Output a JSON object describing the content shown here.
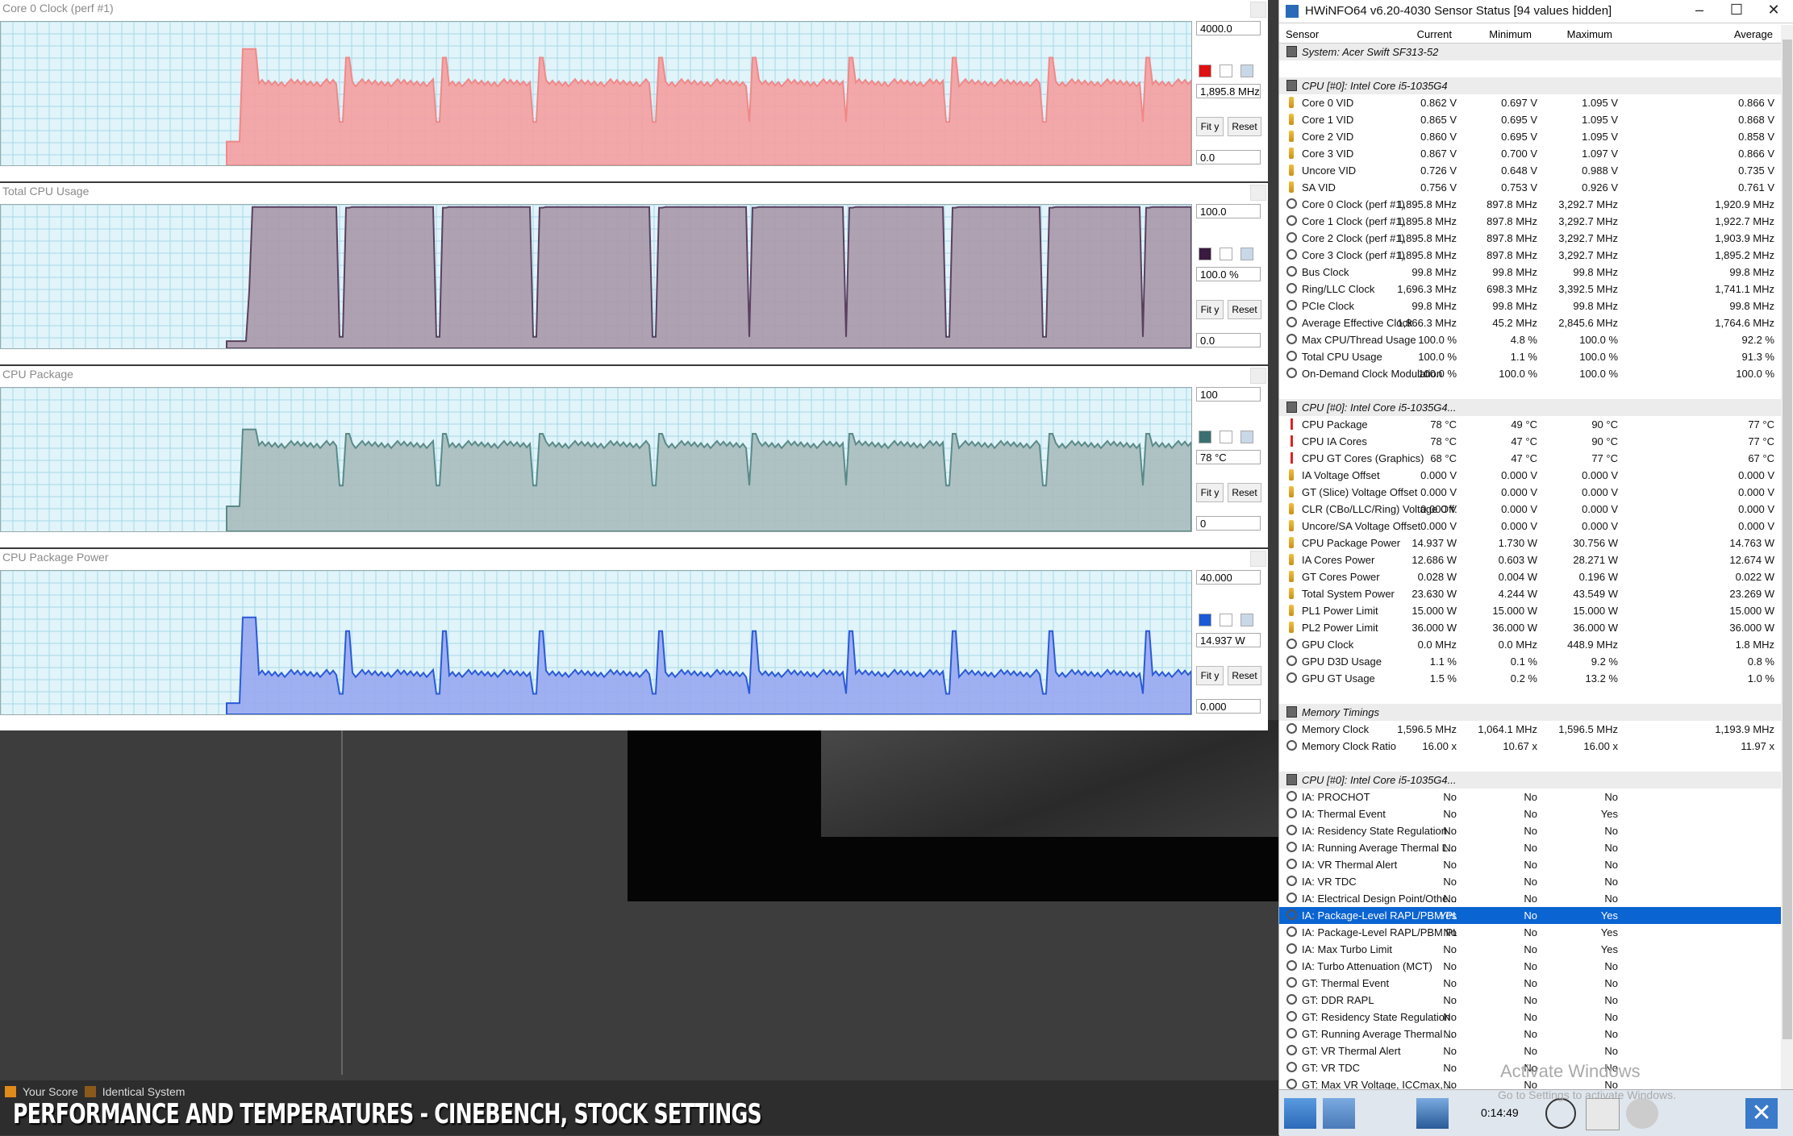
{
  "graphs": [
    {
      "title": "Core 0 Clock (perf #1)",
      "max": "4000.0",
      "current": "1,895.8 MHz",
      "min": "0.0",
      "fit": "Fit y",
      "reset": "Reset",
      "color": "#f08888",
      "fill": "#f4a0a0",
      "swatch": "#e01010"
    },
    {
      "title": "Total CPU Usage",
      "max": "100.0",
      "current": "100.0 %",
      "min": "0.0",
      "fit": "Fit y",
      "reset": "Reset",
      "color": "#5a4060",
      "fill": "#a898a8",
      "swatch": "#3a1a40"
    },
    {
      "title": "CPU Package",
      "max": "100",
      "current": "78 °C",
      "min": "0",
      "fit": "Fit y",
      "reset": "Reset",
      "color": "#5a8a88",
      "fill": "#a8bcbc",
      "swatch": "#3a7070"
    },
    {
      "title": "CPU Package Power",
      "max": "40.000",
      "current": "14.937 W",
      "min": "0.000",
      "fit": "Fit y",
      "reset": "Reset",
      "color": "#2a5ad8",
      "fill": "#98a8f0",
      "swatch": "#1a5ad8"
    }
  ],
  "hwinfo": {
    "title": "HWiNFO64 v6.20-4030 Sensor Status [94 values hidden]",
    "headers": [
      "Sensor",
      "Current",
      "Minimum",
      "Maximum",
      "Average"
    ],
    "rows": [
      {
        "name": "System: Acer Swift SF313-52",
        "group": true,
        "icon": "chip"
      },
      {
        "spacer": true
      },
      {
        "name": "CPU [#0]: Intel Core i5-1035G4",
        "group": true,
        "icon": "chip"
      },
      {
        "name": "Core 0 VID",
        "icon": "volt",
        "v": [
          "0.862 V",
          "0.697 V",
          "1.095 V",
          "0.866 V"
        ]
      },
      {
        "name": "Core 1 VID",
        "icon": "volt",
        "v": [
          "0.865 V",
          "0.695 V",
          "1.095 V",
          "0.868 V"
        ]
      },
      {
        "name": "Core 2 VID",
        "icon": "volt",
        "v": [
          "0.860 V",
          "0.695 V",
          "1.095 V",
          "0.858 V"
        ]
      },
      {
        "name": "Core 3 VID",
        "icon": "volt",
        "v": [
          "0.867 V",
          "0.700 V",
          "1.097 V",
          "0.866 V"
        ]
      },
      {
        "name": "Uncore VID",
        "icon": "volt",
        "v": [
          "0.726 V",
          "0.648 V",
          "0.988 V",
          "0.735 V"
        ]
      },
      {
        "name": "SA VID",
        "icon": "volt",
        "v": [
          "0.756 V",
          "0.753 V",
          "0.926 V",
          "0.761 V"
        ]
      },
      {
        "name": "Core 0 Clock (perf #1)",
        "icon": "clock",
        "v": [
          "1,895.8 MHz",
          "897.8 MHz",
          "3,292.7 MHz",
          "1,920.9 MHz"
        ]
      },
      {
        "name": "Core 1 Clock (perf #1)",
        "icon": "clock",
        "v": [
          "1,895.8 MHz",
          "897.8 MHz",
          "3,292.7 MHz",
          "1,922.7 MHz"
        ]
      },
      {
        "name": "Core 2 Clock (perf #1)",
        "icon": "clock",
        "v": [
          "1,895.8 MHz",
          "897.8 MHz",
          "3,292.7 MHz",
          "1,903.9 MHz"
        ]
      },
      {
        "name": "Core 3 Clock (perf #1)",
        "icon": "clock",
        "v": [
          "1,895.8 MHz",
          "897.8 MHz",
          "3,292.7 MHz",
          "1,895.2 MHz"
        ]
      },
      {
        "name": "Bus Clock",
        "icon": "clock",
        "v": [
          "99.8 MHz",
          "99.8 MHz",
          "99.8 MHz",
          "99.8 MHz"
        ]
      },
      {
        "name": "Ring/LLC Clock",
        "icon": "clock",
        "v": [
          "1,696.3 MHz",
          "698.3 MHz",
          "3,392.5 MHz",
          "1,741.1 MHz"
        ]
      },
      {
        "name": "PCIe Clock",
        "icon": "clock",
        "v": [
          "99.8 MHz",
          "99.8 MHz",
          "99.8 MHz",
          "99.8 MHz"
        ]
      },
      {
        "name": "Average Effective Clock",
        "icon": "clock",
        "v": [
          "1,866.3 MHz",
          "45.2 MHz",
          "2,845.6 MHz",
          "1,764.6 MHz"
        ]
      },
      {
        "name": "Max CPU/Thread Usage",
        "icon": "clock",
        "v": [
          "100.0 %",
          "4.8 %",
          "100.0 %",
          "92.2 %"
        ]
      },
      {
        "name": "Total CPU Usage",
        "icon": "clock",
        "v": [
          "100.0 %",
          "1.1 %",
          "100.0 %",
          "91.3 %"
        ]
      },
      {
        "name": "On-Demand Clock Modulation",
        "icon": "clock",
        "v": [
          "100.0 %",
          "100.0 %",
          "100.0 %",
          "100.0 %"
        ]
      },
      {
        "spacer": true
      },
      {
        "name": "CPU [#0]: Intel Core i5-1035G4...",
        "group": true,
        "icon": "chip"
      },
      {
        "name": "CPU Package",
        "icon": "temp",
        "v": [
          "78 °C",
          "49 °C",
          "90 °C",
          "77 °C"
        ]
      },
      {
        "name": "CPU IA Cores",
        "icon": "temp",
        "v": [
          "78 °C",
          "47 °C",
          "90 °C",
          "77 °C"
        ]
      },
      {
        "name": "CPU GT Cores (Graphics)",
        "icon": "temp",
        "v": [
          "68 °C",
          "47 °C",
          "77 °C",
          "67 °C"
        ]
      },
      {
        "name": "IA Voltage Offset",
        "icon": "volt",
        "v": [
          "0.000 V",
          "0.000 V",
          "0.000 V",
          "0.000 V"
        ]
      },
      {
        "name": "GT (Slice) Voltage Offset",
        "icon": "volt",
        "v": [
          "0.000 V",
          "0.000 V",
          "0.000 V",
          "0.000 V"
        ]
      },
      {
        "name": "CLR (CBo/LLC/Ring) Voltage Off...",
        "icon": "volt",
        "v": [
          "0.000 V",
          "0.000 V",
          "0.000 V",
          "0.000 V"
        ]
      },
      {
        "name": "Uncore/SA Voltage Offset",
        "icon": "volt",
        "v": [
          "0.000 V",
          "0.000 V",
          "0.000 V",
          "0.000 V"
        ]
      },
      {
        "name": "CPU Package Power",
        "icon": "volt",
        "v": [
          "14.937 W",
          "1.730 W",
          "30.756 W",
          "14.763 W"
        ]
      },
      {
        "name": "IA Cores Power",
        "icon": "volt",
        "v": [
          "12.686 W",
          "0.603 W",
          "28.271 W",
          "12.674 W"
        ]
      },
      {
        "name": "GT Cores Power",
        "icon": "volt",
        "v": [
          "0.028 W",
          "0.004 W",
          "0.196 W",
          "0.022 W"
        ]
      },
      {
        "name": "Total System Power",
        "icon": "volt",
        "v": [
          "23.630 W",
          "4.244 W",
          "43.549 W",
          "23.269 W"
        ]
      },
      {
        "name": "PL1 Power Limit",
        "icon": "volt",
        "v": [
          "15.000 W",
          "15.000 W",
          "15.000 W",
          "15.000 W"
        ]
      },
      {
        "name": "PL2 Power Limit",
        "icon": "volt",
        "v": [
          "36.000 W",
          "36.000 W",
          "36.000 W",
          "36.000 W"
        ]
      },
      {
        "name": "GPU Clock",
        "icon": "clock",
        "v": [
          "0.0 MHz",
          "0.0 MHz",
          "448.9 MHz",
          "1.8 MHz"
        ]
      },
      {
        "name": "GPU D3D Usage",
        "icon": "clock",
        "v": [
          "1.1 %",
          "0.1 %",
          "9.2 %",
          "0.8 %"
        ]
      },
      {
        "name": "GPU GT Usage",
        "icon": "clock",
        "v": [
          "1.5 %",
          "0.2 %",
          "13.2 %",
          "1.0 %"
        ]
      },
      {
        "spacer": true
      },
      {
        "name": "Memory Timings",
        "group": true,
        "icon": "chip"
      },
      {
        "name": "Memory Clock",
        "icon": "clock",
        "v": [
          "1,596.5 MHz",
          "1,064.1 MHz",
          "1,596.5 MHz",
          "1,193.9 MHz"
        ]
      },
      {
        "name": "Memory Clock Ratio",
        "icon": "clock",
        "v": [
          "16.00 x",
          "10.67 x",
          "16.00 x",
          "11.97 x"
        ]
      },
      {
        "spacer": true
      },
      {
        "name": "CPU [#0]: Intel Core i5-1035G4...",
        "group": true,
        "icon": "chip"
      },
      {
        "name": "IA: PROCHOT",
        "icon": "clock",
        "v": [
          "No",
          "No",
          "No",
          ""
        ]
      },
      {
        "name": "IA: Thermal Event",
        "icon": "clock",
        "v": [
          "No",
          "No",
          "Yes",
          ""
        ]
      },
      {
        "name": "IA: Residency State Regulation",
        "icon": "clock",
        "v": [
          "No",
          "No",
          "No",
          ""
        ]
      },
      {
        "name": "IA: Running Average Thermal L...",
        "icon": "clock",
        "v": [
          "No",
          "No",
          "No",
          ""
        ]
      },
      {
        "name": "IA: VR Thermal Alert",
        "icon": "clock",
        "v": [
          "No",
          "No",
          "No",
          ""
        ]
      },
      {
        "name": "IA: VR TDC",
        "icon": "clock",
        "v": [
          "No",
          "No",
          "No",
          ""
        ]
      },
      {
        "name": "IA: Electrical Design Point/Othe...",
        "icon": "clock",
        "v": [
          "No",
          "No",
          "No",
          ""
        ]
      },
      {
        "name": "IA: Package-Level RAPL/PBM PL1",
        "icon": "clock",
        "v": [
          "Yes",
          "No",
          "Yes",
          ""
        ],
        "selected": true
      },
      {
        "name": "IA: Package-Level RAPL/PBM PL...",
        "icon": "clock",
        "v": [
          "No",
          "No",
          "Yes",
          ""
        ]
      },
      {
        "name": "IA: Max Turbo Limit",
        "icon": "clock",
        "v": [
          "No",
          "No",
          "Yes",
          ""
        ]
      },
      {
        "name": "IA: Turbo Attenuation (MCT)",
        "icon": "clock",
        "v": [
          "No",
          "No",
          "No",
          ""
        ]
      },
      {
        "name": "GT: Thermal Event",
        "icon": "clock",
        "v": [
          "No",
          "No",
          "No",
          ""
        ]
      },
      {
        "name": "GT: DDR RAPL",
        "icon": "clock",
        "v": [
          "No",
          "No",
          "No",
          ""
        ]
      },
      {
        "name": "GT: Residency State Regulation",
        "icon": "clock",
        "v": [
          "No",
          "No",
          "No",
          ""
        ]
      },
      {
        "name": "GT: Running Average Thermal ...",
        "icon": "clock",
        "v": [
          "No",
          "No",
          "No",
          ""
        ]
      },
      {
        "name": "GT: VR Thermal Alert",
        "icon": "clock",
        "v": [
          "No",
          "No",
          "No",
          ""
        ]
      },
      {
        "name": "GT: VR TDC",
        "icon": "clock",
        "v": [
          "No",
          "No",
          "No",
          ""
        ]
      },
      {
        "name": "GT: Max VR Voltage, ICCmax, ...",
        "icon": "clock",
        "v": [
          "No",
          "No",
          "No",
          ""
        ]
      }
    ],
    "time": "0:14:49"
  },
  "bench": {
    "your_score": "Your Score",
    "identical": "Identical System",
    "caption": "PERFORMANCE AND TEMPERATURES - CINEBENCH, STOCK SETTINGS"
  },
  "watermark": {
    "line1": "Activate Windows",
    "line2": "Go to Settings to activate Windows."
  }
}
